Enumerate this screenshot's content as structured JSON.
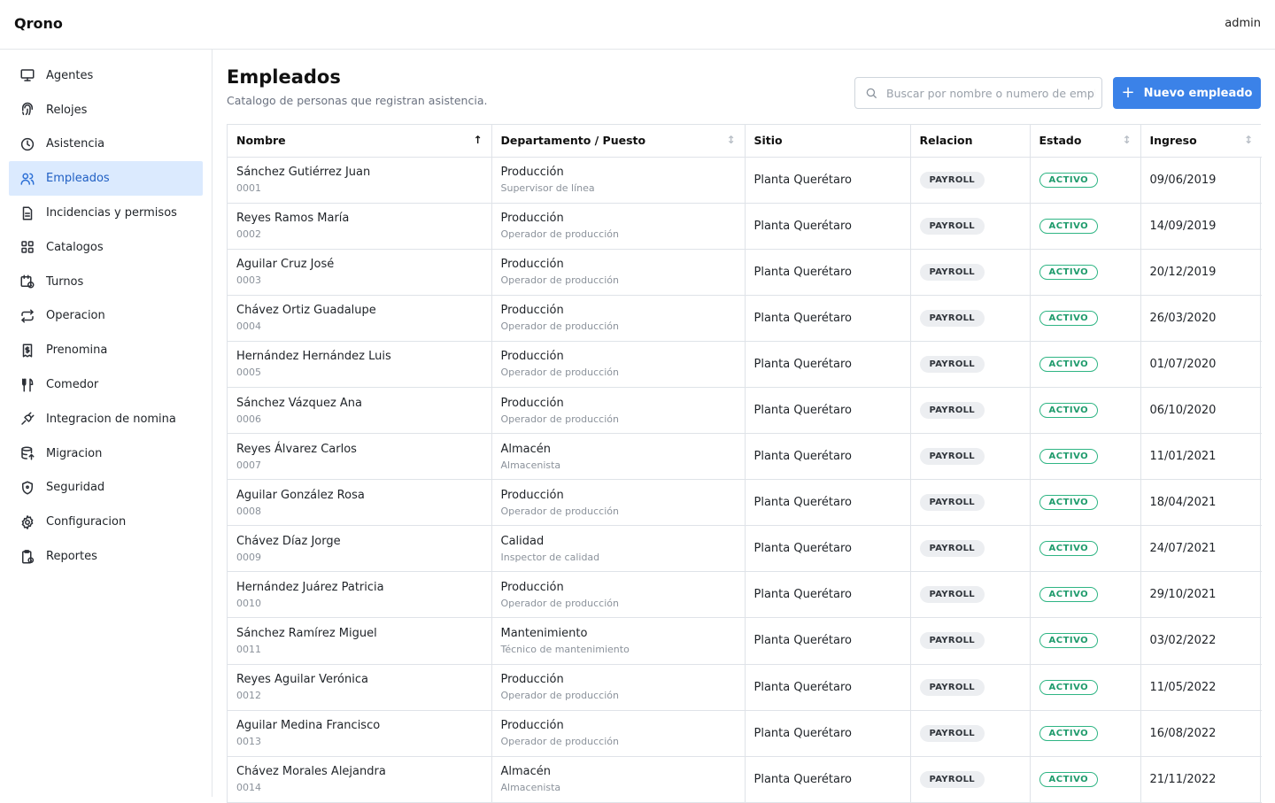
{
  "app": {
    "brand": "Qrono",
    "user": "admin"
  },
  "sidebar": {
    "items": [
      {
        "label": "Agentes",
        "icon": "monitor-icon",
        "active": false
      },
      {
        "label": "Relojes",
        "icon": "fingerprint-icon",
        "active": false
      },
      {
        "label": "Asistencia",
        "icon": "clock-icon",
        "active": false
      },
      {
        "label": "Empleados",
        "icon": "users-icon",
        "active": true
      },
      {
        "label": "Incidencias y permisos",
        "icon": "file-text-icon",
        "active": false
      },
      {
        "label": "Catalogos",
        "icon": "grid-icon",
        "active": false
      },
      {
        "label": "Turnos",
        "icon": "calendar-clock-icon",
        "active": false
      },
      {
        "label": "Operacion",
        "icon": "repeat-icon",
        "active": false
      },
      {
        "label": "Prenomina",
        "icon": "receipt-icon",
        "active": false
      },
      {
        "label": "Comedor",
        "icon": "utensils-icon",
        "active": false
      },
      {
        "label": "Integracion de nomina",
        "icon": "plug-icon",
        "active": false
      },
      {
        "label": "Migracion",
        "icon": "database-icon",
        "active": false
      },
      {
        "label": "Seguridad",
        "icon": "shield-icon",
        "active": false
      },
      {
        "label": "Configuracion",
        "icon": "gear-icon",
        "active": false
      },
      {
        "label": "Reportes",
        "icon": "clipboard-icon",
        "active": false
      }
    ]
  },
  "header": {
    "title": "Empleados",
    "subtitle": "Catalogo de personas que registran asistencia.",
    "search_placeholder": "Buscar por nombre o numero de empleado",
    "new_button_label": "Nuevo empleado"
  },
  "table": {
    "columns": [
      {
        "label": "Nombre",
        "sort": "asc"
      },
      {
        "label": "Departamento / Puesto",
        "sort": "none"
      },
      {
        "label": "Sitio",
        "sort": ""
      },
      {
        "label": "Relacion",
        "sort": ""
      },
      {
        "label": "Estado",
        "sort": "none"
      },
      {
        "label": "Ingreso",
        "sort": "none"
      }
    ],
    "rows": [
      {
        "name": "Sánchez Gutiérrez Juan",
        "id": "0001",
        "dept": "Producción",
        "position": "Supervisor de línea",
        "site": "Planta Querétaro",
        "relation": "PAYROLL",
        "status": "ACTIVO",
        "hired": "09/06/2019"
      },
      {
        "name": "Reyes Ramos María",
        "id": "0002",
        "dept": "Producción",
        "position": "Operador de producción",
        "site": "Planta Querétaro",
        "relation": "PAYROLL",
        "status": "ACTIVO",
        "hired": "14/09/2019"
      },
      {
        "name": "Aguilar Cruz José",
        "id": "0003",
        "dept": "Producción",
        "position": "Operador de producción",
        "site": "Planta Querétaro",
        "relation": "PAYROLL",
        "status": "ACTIVO",
        "hired": "20/12/2019"
      },
      {
        "name": "Chávez Ortiz Guadalupe",
        "id": "0004",
        "dept": "Producción",
        "position": "Operador de producción",
        "site": "Planta Querétaro",
        "relation": "PAYROLL",
        "status": "ACTIVO",
        "hired": "26/03/2020"
      },
      {
        "name": "Hernández Hernández Luis",
        "id": "0005",
        "dept": "Producción",
        "position": "Operador de producción",
        "site": "Planta Querétaro",
        "relation": "PAYROLL",
        "status": "ACTIVO",
        "hired": "01/07/2020"
      },
      {
        "name": "Sánchez Vázquez Ana",
        "id": "0006",
        "dept": "Producción",
        "position": "Operador de producción",
        "site": "Planta Querétaro",
        "relation": "PAYROLL",
        "status": "ACTIVO",
        "hired": "06/10/2020"
      },
      {
        "name": "Reyes Álvarez Carlos",
        "id": "0007",
        "dept": "Almacén",
        "position": "Almacenista",
        "site": "Planta Querétaro",
        "relation": "PAYROLL",
        "status": "ACTIVO",
        "hired": "11/01/2021"
      },
      {
        "name": "Aguilar González Rosa",
        "id": "0008",
        "dept": "Producción",
        "position": "Operador de producción",
        "site": "Planta Querétaro",
        "relation": "PAYROLL",
        "status": "ACTIVO",
        "hired": "18/04/2021"
      },
      {
        "name": "Chávez Díaz Jorge",
        "id": "0009",
        "dept": "Calidad",
        "position": "Inspector de calidad",
        "site": "Planta Querétaro",
        "relation": "PAYROLL",
        "status": "ACTIVO",
        "hired": "24/07/2021"
      },
      {
        "name": "Hernández Juárez Patricia",
        "id": "0010",
        "dept": "Producción",
        "position": "Operador de producción",
        "site": "Planta Querétaro",
        "relation": "PAYROLL",
        "status": "ACTIVO",
        "hired": "29/10/2021"
      },
      {
        "name": "Sánchez Ramírez Miguel",
        "id": "0011",
        "dept": "Mantenimiento",
        "position": "Técnico de mantenimiento",
        "site": "Planta Querétaro",
        "relation": "PAYROLL",
        "status": "ACTIVO",
        "hired": "03/02/2022"
      },
      {
        "name": "Reyes Aguilar Verónica",
        "id": "0012",
        "dept": "Producción",
        "position": "Operador de producción",
        "site": "Planta Querétaro",
        "relation": "PAYROLL",
        "status": "ACTIVO",
        "hired": "11/05/2022"
      },
      {
        "name": "Aguilar Medina Francisco",
        "id": "0013",
        "dept": "Producción",
        "position": "Operador de producción",
        "site": "Planta Querétaro",
        "relation": "PAYROLL",
        "status": "ACTIVO",
        "hired": "16/08/2022"
      },
      {
        "name": "Chávez Morales Alejandra",
        "id": "0014",
        "dept": "Almacén",
        "position": "Almacenista",
        "site": "Planta Querétaro",
        "relation": "PAYROLL",
        "status": "ACTIVO",
        "hired": "21/11/2022"
      }
    ]
  },
  "colors": {
    "accent": "#3b82e8",
    "active_bg": "#dbeafe",
    "status_green": "#1f9b6c"
  }
}
